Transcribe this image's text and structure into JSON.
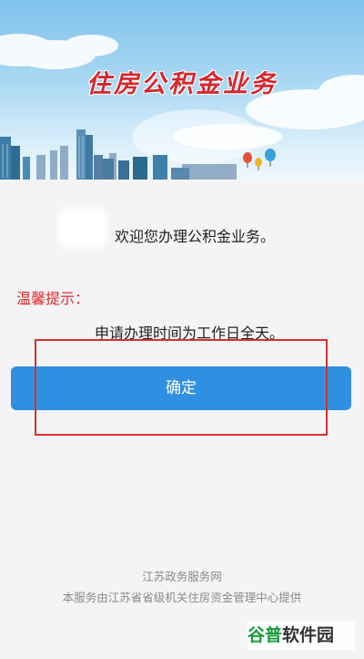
{
  "banner": {
    "title": "住房公积金业务"
  },
  "content": {
    "welcome_text": "欢迎您办理公积金业务。",
    "tip_label": "温馨提示：",
    "tip_text": "申请办理时间为工作日全天。"
  },
  "actions": {
    "confirm_label": "确定"
  },
  "footer": {
    "line1": "江苏政务服务网",
    "line2": "本服务由江苏省省级机关住房资金管理中心提供"
  },
  "watermark": {
    "part1": "谷普",
    "part2": "软件园"
  },
  "colors": {
    "title_red": "#d8262c",
    "button_blue": "#2f8fe0",
    "tip_red": "#e02a2a",
    "annotation_red": "#d9302c"
  }
}
